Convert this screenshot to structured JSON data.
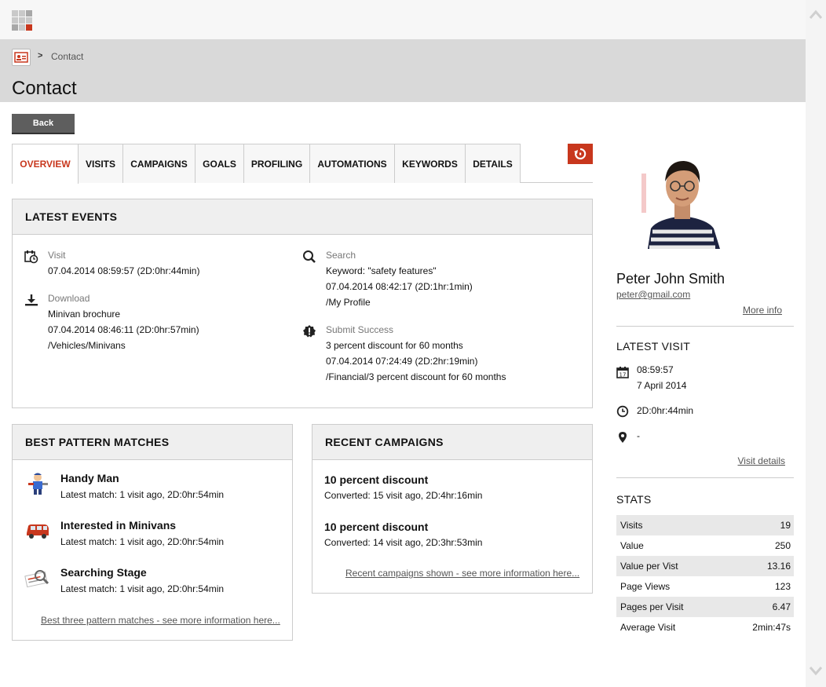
{
  "header": {
    "breadcrumb_sep": ">",
    "breadcrumb_label": "Contact",
    "title": "Contact"
  },
  "back_label": "Back",
  "tabs": [
    {
      "label": "OVERVIEW",
      "active": true
    },
    {
      "label": "VISITS"
    },
    {
      "label": "CAMPAIGNS"
    },
    {
      "label": "GOALS"
    },
    {
      "label": "PROFILING"
    },
    {
      "label": "AUTOMATIONS"
    },
    {
      "label": "KEYWORDS"
    },
    {
      "label": "DETAILS"
    }
  ],
  "latest_events": {
    "title": "LATEST EVENTS",
    "events": [
      {
        "icon": "calendar-clock-icon",
        "title": "Visit",
        "lines": [
          "07.04.2014 08:59:57 (2D:0hr:44min)"
        ]
      },
      {
        "icon": "download-icon",
        "title": "Download",
        "lines": [
          "Minivan brochure",
          "07.04.2014 08:46:11 (2D:0hr:57min)",
          "/Vehicles/Minivans"
        ]
      },
      {
        "icon": "search-icon",
        "title": "Search",
        "lines": [
          "Keyword: \"safety features\"",
          "07.04.2014 08:42:17 (2D:1hr:1min)",
          "/My Profile"
        ]
      },
      {
        "icon": "alert-badge-icon",
        "title": "Submit Success",
        "lines": [
          "3 percent discount for 60 months",
          "07.04.2014 07:24:49 (2D:2hr:19min)",
          "/Financial/3 percent discount for 60 months"
        ]
      }
    ]
  },
  "pattern_matches": {
    "title": "BEST PATTERN MATCHES",
    "items": [
      {
        "icon": "handyman-icon",
        "name": "Handy Man",
        "detail": "Latest match: 1 visit ago, 2D:0hr:54min"
      },
      {
        "icon": "minivan-icon",
        "name": "Interested in Minivans",
        "detail": "Latest match: 1 visit ago, 2D:0hr:54min"
      },
      {
        "icon": "magnifier-document-icon",
        "name": "Searching Stage",
        "detail": "Latest match: 1 visit ago, 2D:0hr:54min"
      }
    ],
    "more_link": "Best three pattern matches - see more information here..."
  },
  "recent_campaigns": {
    "title": "RECENT CAMPAIGNS",
    "items": [
      {
        "name": "10 percent discount",
        "detail": "Converted: 15 visit ago, 2D:4hr:16min"
      },
      {
        "name": "10 percent discount",
        "detail": "Converted: 14 visit ago, 2D:3hr:53min"
      }
    ],
    "more_link": "Recent campaigns shown - see more information here..."
  },
  "contact": {
    "name": "Peter John Smith",
    "email": "peter@gmail.com",
    "more_info": "More info"
  },
  "latest_visit": {
    "title": "LATEST VISIT",
    "time": "08:59:57",
    "date": "7 April 2014",
    "duration": "2D:0hr:44min",
    "location": "-",
    "details_link": "Visit details"
  },
  "stats": {
    "title": "STATS",
    "rows": [
      {
        "label": "Visits",
        "value": "19"
      },
      {
        "label": "Value",
        "value": "250"
      },
      {
        "label": "Value per Vist",
        "value": "13.16"
      },
      {
        "label": "Page Views",
        "value": "123"
      },
      {
        "label": "Pages per Visit",
        "value": "6.47"
      },
      {
        "label": "Average Visit",
        "value": "2min:47s"
      }
    ]
  },
  "colors": {
    "accent": "#c8371d",
    "header_bg": "#d9d9d9",
    "panel_head_bg": "#efefef",
    "button_bg": "#5e5e5e"
  }
}
